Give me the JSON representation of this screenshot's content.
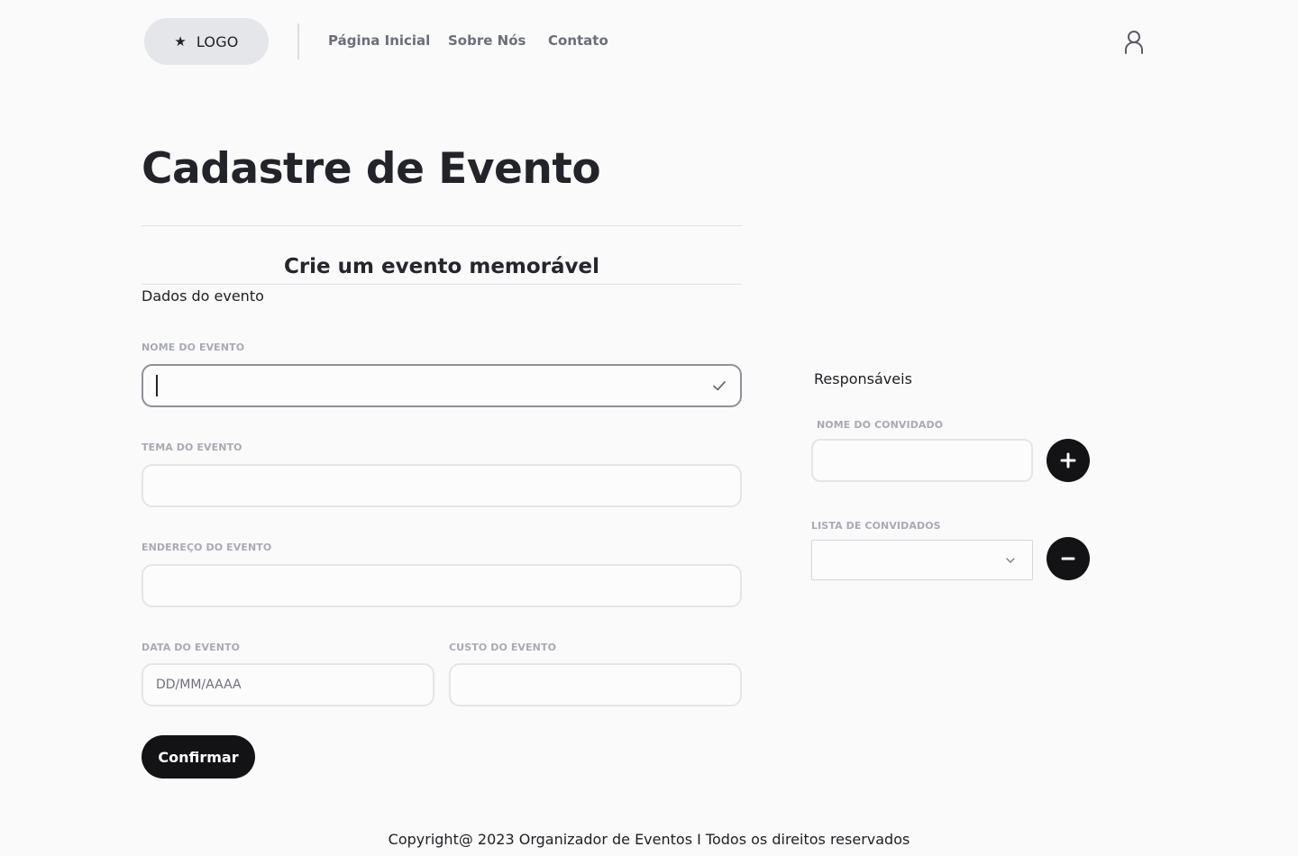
{
  "header": {
    "logo_label": "LOGO",
    "nav": [
      "Página Inicial",
      "Sobre Nós",
      "Contato"
    ]
  },
  "page": {
    "title": "Cadastre de Evento",
    "subtitle": "Crie um evento memorável",
    "section_event": "Dados do evento",
    "section_responsibles": "Responsáveis"
  },
  "form": {
    "event_name": {
      "label": "NOME DO EVENTO",
      "value": ""
    },
    "event_theme": {
      "label": "TEMA DO EVENTO",
      "value": ""
    },
    "event_address": {
      "label": "ENDEREÇO DO EVENTO",
      "value": ""
    },
    "event_date": {
      "label": "DATA DO EVENTO",
      "placeholder": "DD/MM/AAAA"
    },
    "event_cost": {
      "label": "CUSTO DO EVENTO",
      "value": ""
    },
    "confirm_label": "Confirmar"
  },
  "guests": {
    "guest_name_label": "NOME DO CONVIDADO",
    "guest_list_label": "LISTA DE CONVIDADOS",
    "add_icon": "plus-icon",
    "remove_icon": "minus-icon"
  },
  "footer": {
    "text": "Copyright@ 2023 Organizador de Eventos I Todos os direitos reservados"
  },
  "colors": {
    "background": "#fafafb",
    "primary_dark": "#131316",
    "logo_pill": "#e5e6e9",
    "nav_text": "#6c6f79",
    "label_text": "#a9abb2",
    "field_border": "#e4e5e8",
    "field_border_active": "#8e9097"
  }
}
